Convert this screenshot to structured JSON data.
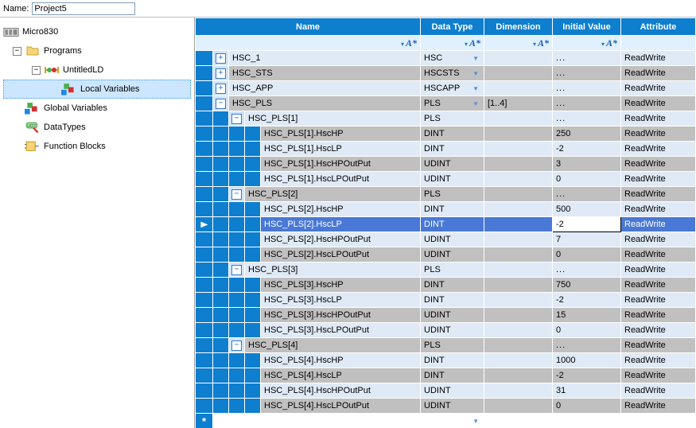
{
  "project": {
    "name_label": "Name:",
    "name_value": "Project5"
  },
  "tree": {
    "controller": "Micro830",
    "programs": "Programs",
    "ld_item": "UntitledLD",
    "local_vars": "Local Variables",
    "global_vars": "Global Variables",
    "data_types": "DataTypes",
    "func_blocks": "Function Blocks"
  },
  "grid": {
    "headers": {
      "name": "Name",
      "type": "Data Type",
      "dim": "Dimension",
      "init": "Initial Value",
      "attr": "Attribute"
    },
    "rows": [
      {
        "kind": "top",
        "exp": "plus",
        "name": "HSC_1",
        "type": "HSC",
        "dim": "",
        "init": "...",
        "attr": "ReadWrite",
        "alt": 0
      },
      {
        "kind": "top",
        "exp": "plus",
        "name": "HSC_STS",
        "type": "HSCSTS",
        "dim": "",
        "init": "...",
        "attr": "ReadWrite",
        "alt": 1
      },
      {
        "kind": "top",
        "exp": "plus",
        "name": "HSC_APP",
        "type": "HSCAPP",
        "dim": "",
        "init": "...",
        "attr": "ReadWrite",
        "alt": 0
      },
      {
        "kind": "top",
        "exp": "minus",
        "name": "HSC_PLS",
        "type": "PLS",
        "typedrop": true,
        "dim": "[1..4]",
        "init": "...",
        "attr": "ReadWrite",
        "alt": 1
      },
      {
        "kind": "sub1",
        "exp": "minus",
        "name": "HSC_PLS[1]",
        "type": "PLS",
        "dim": "",
        "init": "...",
        "attr": "ReadWrite",
        "alt": 0
      },
      {
        "kind": "leaf",
        "name": "HSC_PLS[1].HscHP",
        "type": "DINT",
        "dim": "",
        "init": "250",
        "attr": "ReadWrite",
        "alt": 1
      },
      {
        "kind": "leaf",
        "name": "HSC_PLS[1].HscLP",
        "type": "DINT",
        "dim": "",
        "init": "-2",
        "attr": "ReadWrite",
        "alt": 0
      },
      {
        "kind": "leaf",
        "name": "HSC_PLS[1].HscHPOutPut",
        "type": "UDINT",
        "dim": "",
        "init": "3",
        "attr": "ReadWrite",
        "alt": 1
      },
      {
        "kind": "leaf",
        "name": "HSC_PLS[1].HscLPOutPut",
        "type": "UDINT",
        "dim": "",
        "init": "0",
        "attr": "ReadWrite",
        "alt": 0
      },
      {
        "kind": "sub1",
        "exp": "minus",
        "name": "HSC_PLS[2]",
        "type": "PLS",
        "dim": "",
        "init": "...",
        "attr": "ReadWrite",
        "alt": 1
      },
      {
        "kind": "leaf",
        "name": "HSC_PLS[2].HscHP",
        "type": "DINT",
        "dim": "",
        "init": "500",
        "attr": "ReadWrite",
        "alt": 0
      },
      {
        "kind": "leaf",
        "name": "HSC_PLS[2].HscLP",
        "type": "DINT",
        "dim": "",
        "init": "-2",
        "attr": "ReadWrite",
        "alt": 1,
        "selected": true
      },
      {
        "kind": "leaf",
        "name": "HSC_PLS[2].HscHPOutPut",
        "type": "UDINT",
        "dim": "",
        "init": "7",
        "attr": "ReadWrite",
        "alt": 0
      },
      {
        "kind": "leaf",
        "name": "HSC_PLS[2].HscLPOutPut",
        "type": "UDINT",
        "dim": "",
        "init": "0",
        "attr": "ReadWrite",
        "alt": 1
      },
      {
        "kind": "sub1",
        "exp": "minus",
        "name": "HSC_PLS[3]",
        "type": "PLS",
        "dim": "",
        "init": "...",
        "attr": "ReadWrite",
        "alt": 0
      },
      {
        "kind": "leaf",
        "name": "HSC_PLS[3].HscHP",
        "type": "DINT",
        "dim": "",
        "init": "750",
        "attr": "ReadWrite",
        "alt": 1
      },
      {
        "kind": "leaf",
        "name": "HSC_PLS[3].HscLP",
        "type": "DINT",
        "dim": "",
        "init": "-2",
        "attr": "ReadWrite",
        "alt": 0
      },
      {
        "kind": "leaf",
        "name": "HSC_PLS[3].HscHPOutPut",
        "type": "UDINT",
        "dim": "",
        "init": "15",
        "attr": "ReadWrite",
        "alt": 1
      },
      {
        "kind": "leaf",
        "name": "HSC_PLS[3].HscLPOutPut",
        "type": "UDINT",
        "dim": "",
        "init": "0",
        "attr": "ReadWrite",
        "alt": 0
      },
      {
        "kind": "sub1",
        "exp": "minus",
        "name": "HSC_PLS[4]",
        "type": "PLS",
        "dim": "",
        "init": "...",
        "attr": "ReadWrite",
        "alt": 1
      },
      {
        "kind": "leaf",
        "name": "HSC_PLS[4].HscHP",
        "type": "DINT",
        "dim": "",
        "init": "1000",
        "attr": "ReadWrite",
        "alt": 0
      },
      {
        "kind": "leaf",
        "name": "HSC_PLS[4].HscLP",
        "type": "DINT",
        "dim": "",
        "init": "-2",
        "attr": "ReadWrite",
        "alt": 1
      },
      {
        "kind": "leaf",
        "name": "HSC_PLS[4].HscHPOutPut",
        "type": "UDINT",
        "dim": "",
        "init": "31",
        "attr": "ReadWrite",
        "alt": 0
      },
      {
        "kind": "leaf",
        "name": "HSC_PLS[4].HscLPOutPut",
        "type": "UDINT",
        "dim": "",
        "init": "0",
        "attr": "ReadWrite",
        "alt": 1
      }
    ]
  }
}
